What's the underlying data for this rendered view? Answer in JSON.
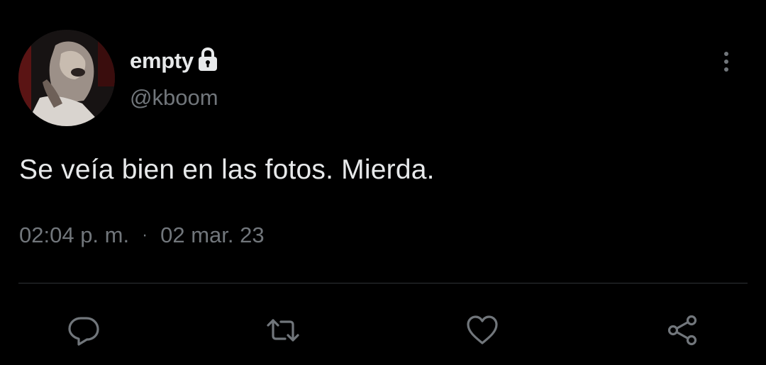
{
  "tweet": {
    "author": {
      "display_name": "empty",
      "handle": "@kboom",
      "protected": true
    },
    "text": "Se veía bien en las fotos. Mierda.",
    "time": "02:04 p. m.",
    "separator": "·",
    "date": "02 mar. 23"
  },
  "actions": [
    {
      "name": "reply",
      "icon": "speech-bubble-icon"
    },
    {
      "name": "retweet",
      "icon": "retweet-arrows-icon"
    },
    {
      "name": "like",
      "icon": "heart-icon"
    },
    {
      "name": "share",
      "icon": "share-nodes-icon"
    }
  ],
  "colors": {
    "background": "#000000",
    "primary_text": "#e7e9ea",
    "secondary_text": "#71767b",
    "divider": "#2f3336"
  }
}
